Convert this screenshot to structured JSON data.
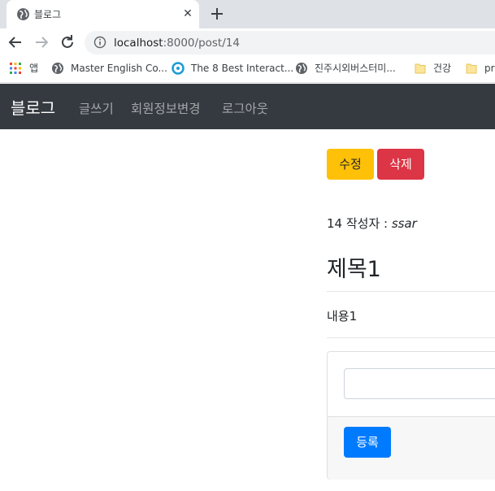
{
  "browser": {
    "tab_title": "블로그",
    "tab_close": "✕",
    "url_host": "localhost",
    "url_rest": ":8000/post/14",
    "bookmarks": [
      {
        "label": "앱",
        "icon": "apps-grid-icon"
      },
      {
        "label": "Master English Co...",
        "icon": "globe-icon"
      },
      {
        "label": "The 8 Best Interact...",
        "icon": "site-logo-icon"
      },
      {
        "label": "진주시외버스터미...",
        "icon": "globe-icon"
      },
      {
        "label": "건강",
        "icon": "folder-icon"
      },
      {
        "label": "pro",
        "icon": "folder-icon"
      }
    ]
  },
  "navbar": {
    "brand": "블로그",
    "links": [
      "글쓰기",
      "회원정보변경",
      "로그아웃"
    ]
  },
  "post": {
    "edit_label": "수정",
    "delete_label": "삭제",
    "id": "14",
    "author_label": " 작성자 : ",
    "author": "ssar",
    "title": "제목1",
    "content": "내용1"
  },
  "reply": {
    "input_value": "",
    "submit_label": "등록"
  },
  "colors": {
    "navbar_bg": "#343a40",
    "warning": "#ffc107",
    "danger": "#dc3545",
    "primary": "#007bff"
  }
}
